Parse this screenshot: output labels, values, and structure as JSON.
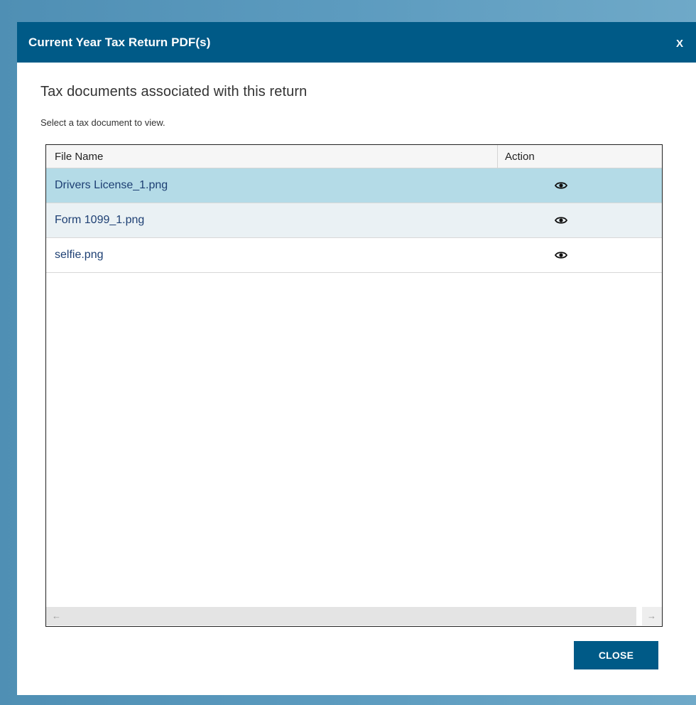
{
  "modal": {
    "title": "Current Year Tax Return PDF(s)",
    "close_x": "X",
    "heading": "Tax documents associated with this return",
    "subtext": "Select a tax document to view.",
    "close_button": "CLOSE"
  },
  "grid": {
    "columns": {
      "file_name": "File Name",
      "action": "Action"
    },
    "rows": [
      {
        "file_name": "Drivers License_1.png",
        "action_icon": "eye-icon",
        "selected": true
      },
      {
        "file_name": "Form 1099_1.png",
        "action_icon": "eye-icon",
        "selected": false
      },
      {
        "file_name": "selfie.png",
        "action_icon": "eye-icon",
        "selected": false
      }
    ],
    "scroll": {
      "left_arrow": "←",
      "right_arrow": "→"
    }
  },
  "colors": {
    "header_bg": "#005a87",
    "selected_row": "#b4dbe7",
    "alt_row": "#eaf1f4",
    "link_text": "#1d3f73"
  }
}
